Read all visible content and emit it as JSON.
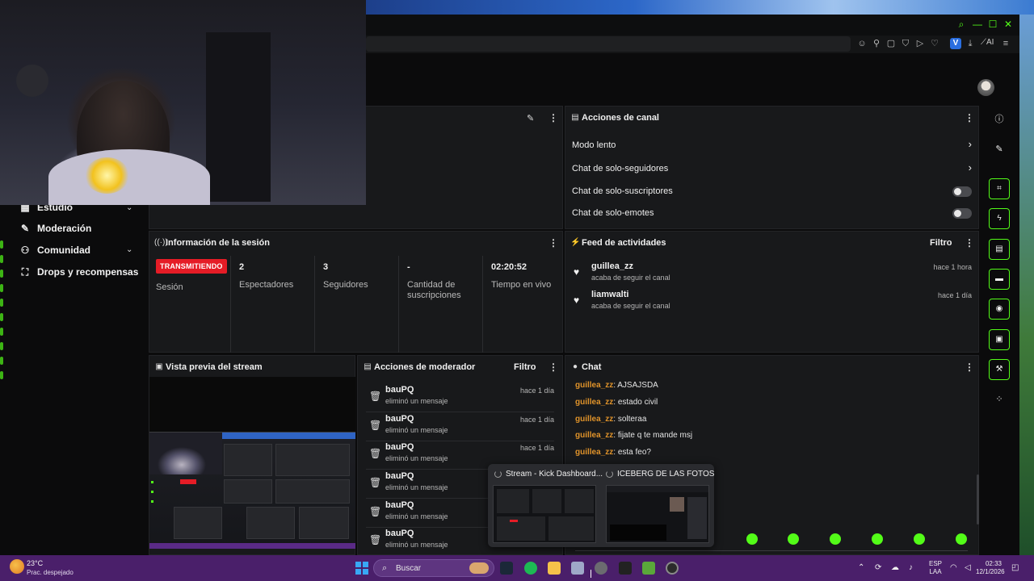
{
  "browser": {
    "window_controls": [
      "⌕",
      "—",
      "☐",
      "✕"
    ],
    "toolbar_icons": [
      "smile",
      "pin",
      "frame",
      "shield",
      "play",
      "heart",
      "V",
      "download",
      "wand"
    ],
    "ai_label": "AI"
  },
  "sidebar": {
    "items": [
      {
        "label": "Estudio",
        "icon": "studio-icon",
        "has_chevron": true
      },
      {
        "label": "Moderación",
        "icon": "wrench-icon",
        "has_chevron": false
      },
      {
        "label": "Comunidad",
        "icon": "people-icon",
        "has_chevron": true
      },
      {
        "label": "Drops y recompensas",
        "icon": "gift-icon",
        "has_chevron": false
      }
    ]
  },
  "channel_actions": {
    "title": "Acciones de canal",
    "rows": [
      {
        "label": "Modo lento",
        "control": "arrow"
      },
      {
        "label": "Chat de solo-seguidores",
        "control": "arrow"
      },
      {
        "label": "Chat de solo-suscriptores",
        "control": "toggle"
      },
      {
        "label": "Chat de solo-emotes",
        "control": "toggle"
      }
    ]
  },
  "session": {
    "title": "Información de la sesión",
    "live_badge": "TRANSMITIENDO",
    "stats": [
      {
        "value": "",
        "label": "Sesión"
      },
      {
        "value": "2",
        "label": "Espectadores"
      },
      {
        "value": "3",
        "label": "Seguidores"
      },
      {
        "value": "-",
        "label": "Cantidad de suscripciones"
      },
      {
        "value": "02:20:52",
        "label": "Tiempo en vivo"
      }
    ]
  },
  "activity_feed": {
    "title": "Feed de actividades",
    "filter": "Filtro",
    "items": [
      {
        "name": "guillea_zz",
        "desc": "acaba de seguir el canal",
        "time": "hace 1 hora"
      },
      {
        "name": "liamwalti",
        "desc": "acaba de seguir el canal",
        "time": "hace 1 día"
      }
    ]
  },
  "stream_preview": {
    "title": "Vista previa del stream"
  },
  "mod_actions": {
    "title": "Acciones de moderador",
    "filter": "Filtro",
    "items": [
      {
        "name": "bauPQ",
        "desc": "eliminó un mensaje",
        "time": "hace 1 día"
      },
      {
        "name": "bauPQ",
        "desc": "eliminó un mensaje",
        "time": "hace 1 día"
      },
      {
        "name": "bauPQ",
        "desc": "eliminó un mensaje",
        "time": "hace 1 día"
      },
      {
        "name": "bauPQ",
        "desc": "eliminó un mensaje",
        "time": ""
      },
      {
        "name": "bauPQ",
        "desc": "eliminó un mensaje",
        "time": ""
      },
      {
        "name": "bauPQ",
        "desc": "eliminó un mensaje",
        "time": ""
      }
    ]
  },
  "chat": {
    "title": "Chat",
    "messages": [
      {
        "user": "guillea_zz",
        "text": "AJSAJSDA"
      },
      {
        "user": "guillea_zz",
        "text": "estado civil"
      },
      {
        "user": "guillea_zz",
        "text": "solteraa"
      },
      {
        "user": "guillea_zz",
        "text": "fijate q te mande msj"
      },
      {
        "user": "guillea_zz",
        "text": "esta feo?"
      }
    ]
  },
  "taskbar_popup": {
    "windows": [
      {
        "title": "Stream - Kick Dashboard..."
      },
      {
        "title": "ICEBERG DE LAS FOTOS..."
      }
    ]
  },
  "taskbar": {
    "weather_temp": "23°C",
    "weather_desc": "Prac. despejado",
    "search_placeholder": "Buscar",
    "lang_line1": "ESP",
    "lang_line2": "LAA",
    "time": "02:33",
    "date": "12/1/2026"
  },
  "colors": {
    "accent": "#53fc18",
    "live": "#e51c26",
    "chat_user": "#e0932a",
    "taskbar": "#4a1f6a"
  }
}
